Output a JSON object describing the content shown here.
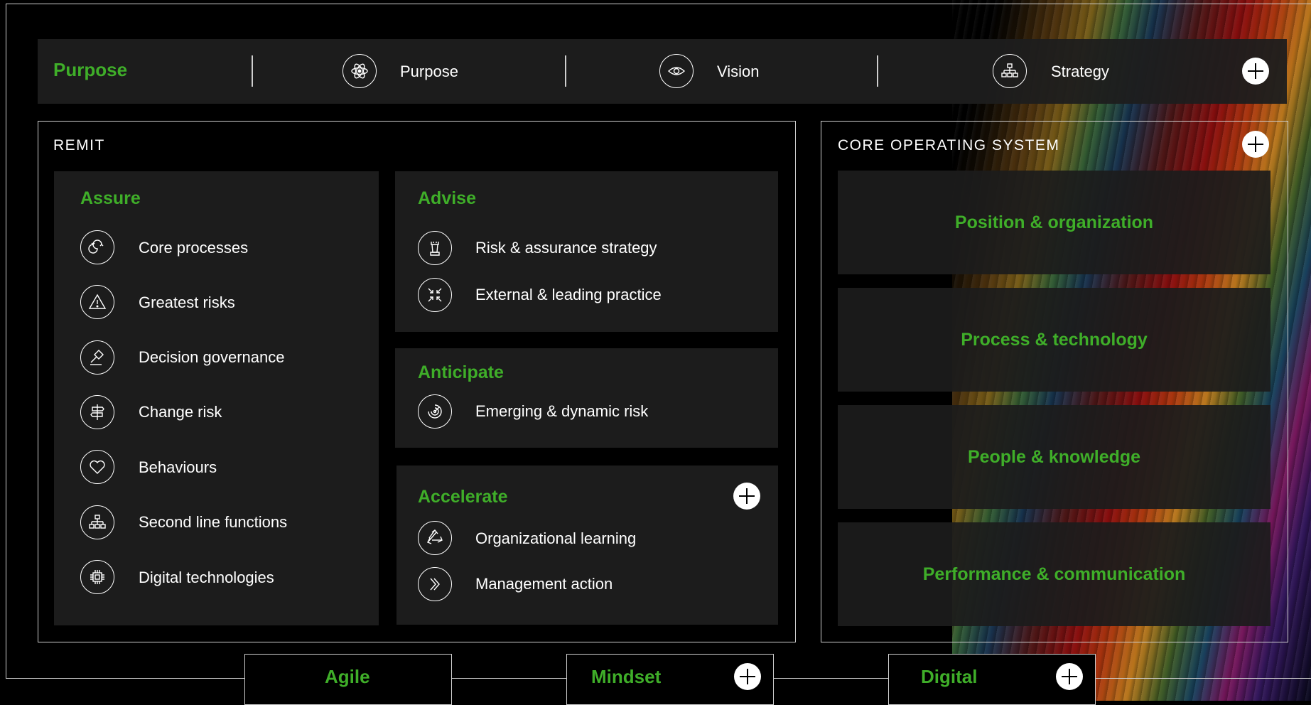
{
  "topbar": {
    "title": "Purpose",
    "items": [
      {
        "label": "Purpose",
        "icon": "atom-icon"
      },
      {
        "label": "Vision",
        "icon": "eye-icon"
      },
      {
        "label": "Strategy",
        "icon": "hierarchy-icon"
      }
    ]
  },
  "remit": {
    "heading": "REMIT",
    "assure": {
      "title": "Assure",
      "items": [
        {
          "label": "Core processes",
          "icon": "cycle-icon"
        },
        {
          "label": "Greatest risks",
          "icon": "warning-icon"
        },
        {
          "label": "Decision governance",
          "icon": "gavel-icon"
        },
        {
          "label": "Change risk",
          "icon": "signpost-icon"
        },
        {
          "label": "Behaviours",
          "icon": "heart-icon"
        },
        {
          "label": "Second line functions",
          "icon": "hierarchy-icon"
        },
        {
          "label": "Digital technologies",
          "icon": "chip-icon"
        }
      ]
    },
    "advise": {
      "title": "Advise",
      "items": [
        {
          "label": "Risk & assurance strategy",
          "icon": "chess-rook-icon"
        },
        {
          "label": "External & leading practice",
          "icon": "compress-arrows-icon"
        }
      ]
    },
    "anticipate": {
      "title": "Anticipate",
      "items": [
        {
          "label": "Emerging & dynamic risk",
          "icon": "radar-icon"
        }
      ]
    },
    "accelerate": {
      "title": "Accelerate",
      "items": [
        {
          "label": "Organizational learning",
          "icon": "recycle-icon"
        },
        {
          "label": "Management action",
          "icon": "double-chevron-icon"
        }
      ]
    }
  },
  "core": {
    "heading": "CORE OPERATING SYSTEM",
    "items": [
      "Position & organization",
      "Process & technology",
      "People & knowledge",
      "Performance & communication"
    ]
  },
  "bottom": {
    "tabs": [
      "Agile",
      "Mindset",
      "Digital"
    ]
  },
  "colors": {
    "accent": "#3fae29",
    "panel": "#1c1c1c",
    "background": "#000000"
  }
}
